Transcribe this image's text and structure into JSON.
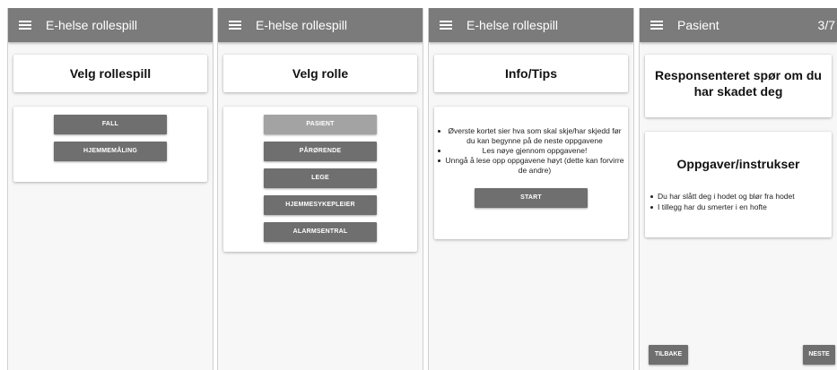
{
  "screens": [
    {
      "appbar_title": "E-helse rollespill",
      "card_title": "Velg rollespill",
      "buttons": [
        "FALL",
        "HJEMMEMÅLING"
      ]
    },
    {
      "appbar_title": "E-helse rollespill",
      "card_title": "Velg rolle",
      "buttons": [
        "PASIENT",
        "PÅRØRENDE",
        "LEGE",
        "HJEMMESYKEPLEIER",
        "ALARMSENTRAL"
      ]
    },
    {
      "appbar_title": "E-helse rollespill",
      "card_title": "Info/Tips",
      "tips": [
        "Øverste kortet sier hva som skal skje/har skjedd før du kan begynne på de neste oppgavene",
        "Les nøye gjennom oppgavene!",
        "Unngå å lese opp oppgavene høyt (dette kan forvirre de andre)"
      ],
      "start_label": "START"
    },
    {
      "appbar_title": "Pasient",
      "counter": "3/7",
      "card_title": "Responsenteret spør om du har skadet deg",
      "tasks_title": "Oppgaver/instrukser",
      "tasks": [
        "Du har slått deg i hodet og blør fra hodet",
        "I tillegg har du smerter i en hofte"
      ],
      "back_label": "TILBAKE",
      "next_label": "NESTE"
    }
  ],
  "colors": {
    "appbar": "#7b7b7b",
    "button": "#6f6f6f",
    "button_highlight": "#a3a3a3",
    "background": "#f7f7f7"
  },
  "icons": {
    "menu": "hamburger-menu-icon"
  }
}
